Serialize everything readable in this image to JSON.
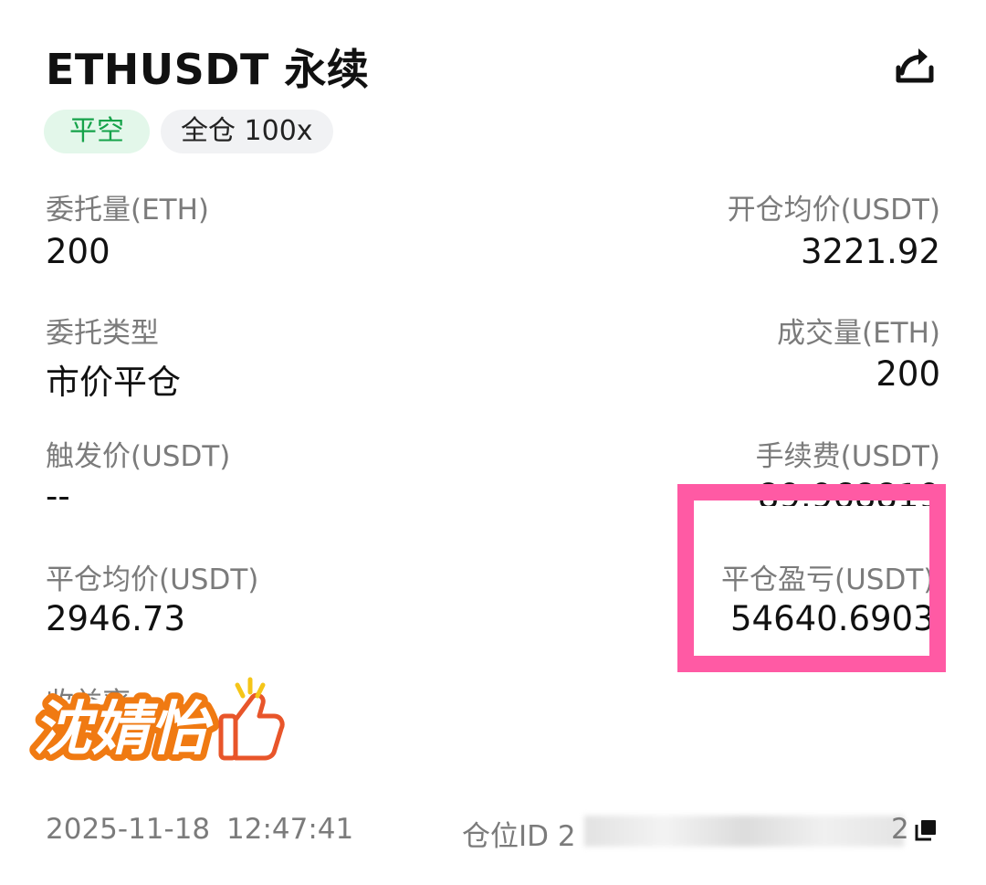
{
  "header": {
    "title": "ETHUSDT 永续",
    "share_icon": "share-icon"
  },
  "tags": {
    "side": "平空",
    "margin_mode": "全仓 100x"
  },
  "fields": {
    "order_qty_label": "委托量(ETH)",
    "order_qty_value": "200",
    "open_avg_label": "开仓均价(USDT)",
    "open_avg_value": "3221.92",
    "order_type_label": "委托类型",
    "order_type_value": "市价平仓",
    "filled_qty_label": "成交量(ETH)",
    "filled_qty_value": "200",
    "trigger_price_label": "触发价(USDT)",
    "trigger_price_value": "--",
    "fee_label": "手续费(USDT)",
    "fee_value": "-89.968819",
    "close_avg_label": "平仓均价(USDT)",
    "close_avg_value": "2946.73",
    "close_pnl_label": "平仓盈亏(USDT)",
    "close_pnl_value": "54640.6903",
    "return_label": "收益率"
  },
  "sticker": {
    "text": "沈婧怡",
    "icon": "thumbs-up-icon"
  },
  "footer": {
    "datetime": "2025-11-18  12:47:41",
    "position_id_label": "仓位ID",
    "position_id_prefix": "2",
    "position_id_suffix": "2",
    "copy_icon": "copy-icon"
  },
  "colors": {
    "highlight": "#ff5aa4",
    "side_tag_bg": "#e3f7ea",
    "side_tag_text": "#16a34a"
  }
}
